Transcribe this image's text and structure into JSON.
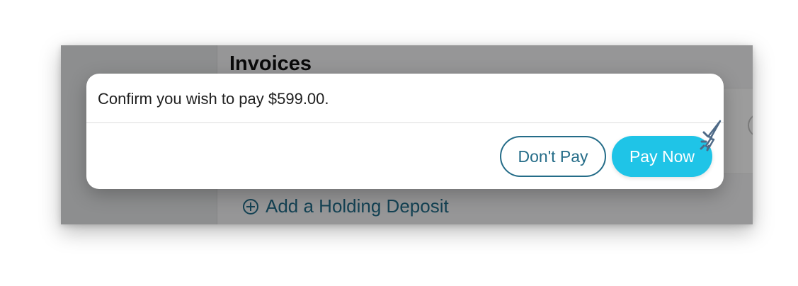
{
  "background_page": {
    "title": "Invoices",
    "add_deposit_label": "Add a Holding Deposit"
  },
  "dialog": {
    "message": "Confirm you wish to pay $599.00.",
    "secondary_action": "Don't Pay",
    "primary_action": "Pay Now"
  },
  "icons": {
    "add": "plus-circle-icon",
    "pointer": "cursor-click-icon"
  },
  "colors": {
    "primary": "#1fc4e7",
    "outline": "#246c88",
    "link": "#216d89",
    "overlay": "#000000"
  }
}
